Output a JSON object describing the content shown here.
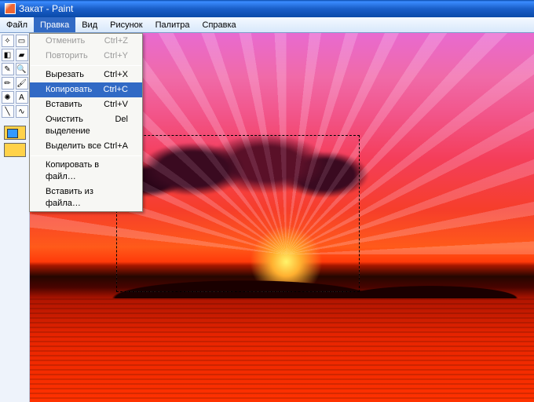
{
  "title": "Закат - Paint",
  "menubar": {
    "items": [
      "Файл",
      "Правка",
      "Вид",
      "Рисунок",
      "Палитра",
      "Справка"
    ],
    "active_index": 1
  },
  "dropdown": {
    "groups": [
      [
        {
          "label": "Отменить",
          "shortcut": "Ctrl+Z",
          "disabled": true
        },
        {
          "label": "Повторить",
          "shortcut": "Ctrl+Y",
          "disabled": true
        }
      ],
      [
        {
          "label": "Вырезать",
          "shortcut": "Ctrl+X",
          "disabled": false
        },
        {
          "label": "Копировать",
          "shortcut": "Ctrl+C",
          "disabled": false,
          "highlighted": true
        },
        {
          "label": "Вставить",
          "shortcut": "Ctrl+V",
          "disabled": false
        },
        {
          "label": "Очистить выделение",
          "shortcut": "Del",
          "disabled": false
        },
        {
          "label": "Выделить все",
          "shortcut": "Ctrl+A",
          "disabled": false
        }
      ],
      [
        {
          "label": "Копировать в файл…",
          "shortcut": "",
          "disabled": false
        },
        {
          "label": "Вставить из файла…",
          "shortcut": "",
          "disabled": false
        }
      ]
    ]
  },
  "tools": [
    "free-select",
    "rect-select",
    "eraser",
    "fill",
    "picker",
    "magnify",
    "pencil",
    "brush",
    "airbrush",
    "text",
    "line",
    "curve"
  ]
}
